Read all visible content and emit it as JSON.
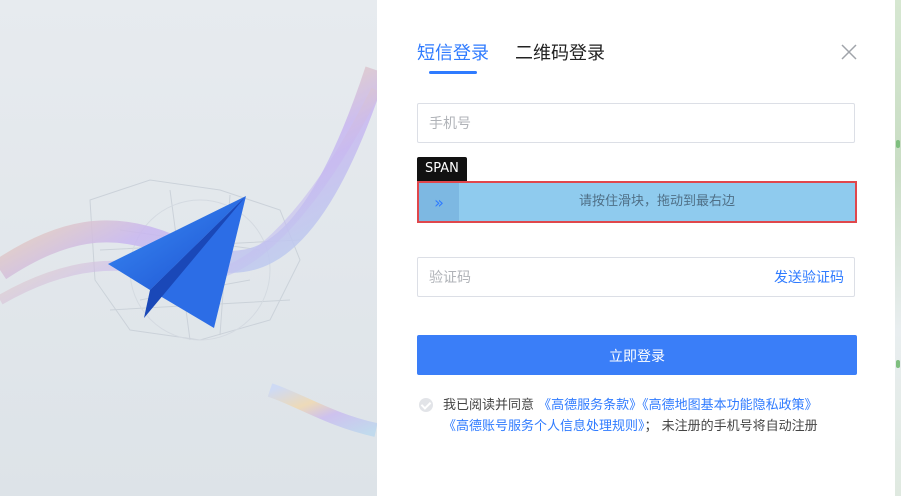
{
  "tabs": [
    {
      "label": "短信登录",
      "active": true
    },
    {
      "label": "二维码登录",
      "active": false
    }
  ],
  "close_icon": "close-icon",
  "phone": {
    "placeholder": "手机号",
    "value": ""
  },
  "tooltip": "SPAN",
  "slider": {
    "text": "请按住滑块，拖动到最右边",
    "handle_icon": "double-chevron-right-icon",
    "progress": 0
  },
  "code": {
    "placeholder": "验证码",
    "send_label": "发送验证码"
  },
  "submit_label": "立即登录",
  "agreement": {
    "prefix": "我已阅读并同意",
    "link1": "《高德服务条款》",
    "link2": "《高德地图基本功能隐私政策》",
    "link3": "《高德账号服务个人信息处理规则》",
    "suffix": "； 未注册的手机号将自动注册",
    "checked": false
  },
  "colors": {
    "accent": "#2f7bff",
    "slider_bg": "#8fcbee",
    "slider_border": "#e0474c"
  }
}
